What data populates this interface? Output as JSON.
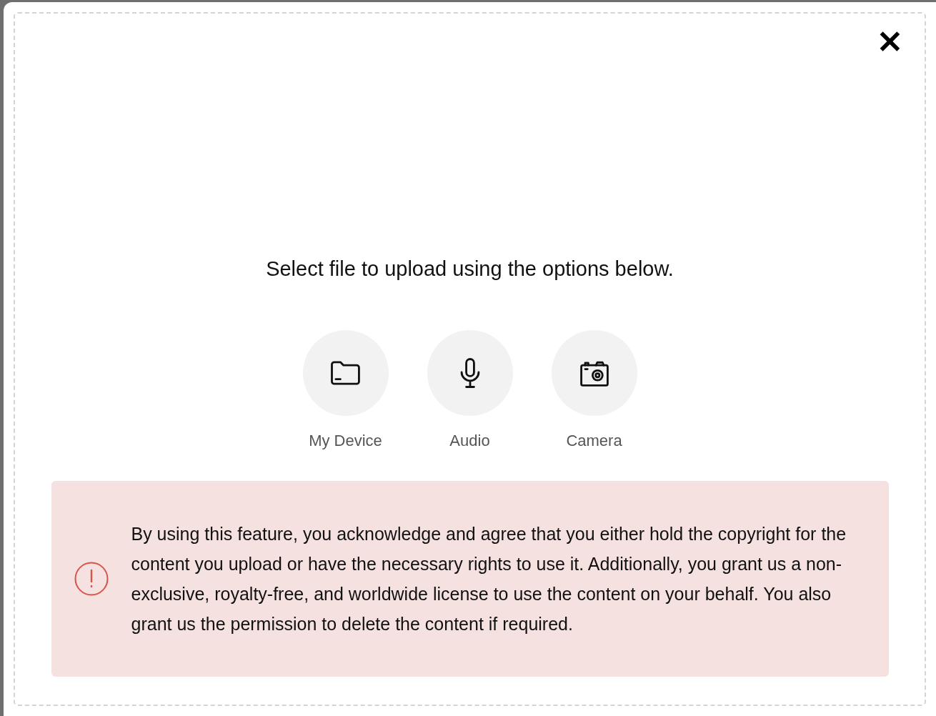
{
  "dialog": {
    "close": "✕",
    "prompt": "Select file to upload using the options below.",
    "options": [
      {
        "kind": "folder",
        "label": "My Device"
      },
      {
        "kind": "microphone",
        "label": "Audio"
      },
      {
        "kind": "camera",
        "label": "Camera"
      }
    ],
    "notice": "By using this feature, you acknowledge and agree that you either hold the copyright for the content you upload or have the necessary rights to use it. Additionally, you grant us a non-exclusive, royalty-free, and worldwide license to use the content on your behalf. You also grant us the permission to delete the content if required."
  }
}
